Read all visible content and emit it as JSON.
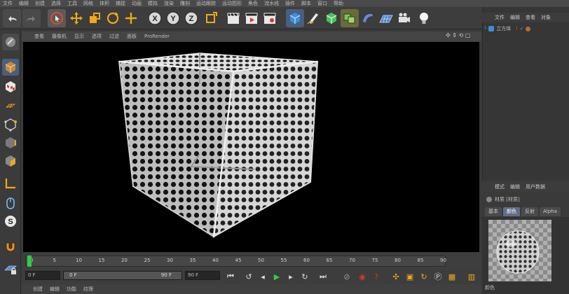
{
  "menubar": {
    "items": [
      "文件",
      "编辑",
      "创建",
      "选择",
      "工具",
      "网格",
      "体积",
      "捕捉",
      "动画",
      "模拟",
      "渲染",
      "雕刻",
      "运动跟踪",
      "运动图形",
      "角色",
      "流水线",
      "插件",
      "脚本",
      "窗口",
      "帮助"
    ]
  },
  "toolbar": {
    "axis_x": "X",
    "axis_y": "Y",
    "axis_z": "Z"
  },
  "viewport": {
    "menu": [
      "查看",
      "摄像机",
      "显示",
      "选项",
      "过滤",
      "面板",
      "ProRender"
    ]
  },
  "timeline": {
    "ticks": [
      "0",
      "5",
      "10",
      "15",
      "20",
      "25",
      "30",
      "35",
      "40",
      "45",
      "50",
      "55",
      "60",
      "65",
      "70",
      "75",
      "80",
      "85",
      "90"
    ],
    "frame_field_right": "0 F",
    "start_field": "0 F",
    "range_start": "0 F",
    "range_end": "90 F",
    "end_field": "90 F"
  },
  "bottombar": {
    "items": [
      "创建",
      "编辑",
      "功能",
      "纹理"
    ]
  },
  "objects_panel": {
    "menu": [
      "文件",
      "编辑",
      "查看",
      "对象"
    ],
    "object_name": "立方体"
  },
  "attributes_panel": {
    "menu": [
      "模式",
      "编辑",
      "用户数据"
    ],
    "material_title": "材质 [材质]",
    "tabs": [
      "基本",
      "颜色",
      "反射",
      "Alpha"
    ],
    "active_tab": "颜色",
    "channel_label": "颜色"
  },
  "colors": {
    "accent": "#5c6f8a",
    "play_green": "#2fcf3f",
    "record_red": "#d33a2a"
  }
}
